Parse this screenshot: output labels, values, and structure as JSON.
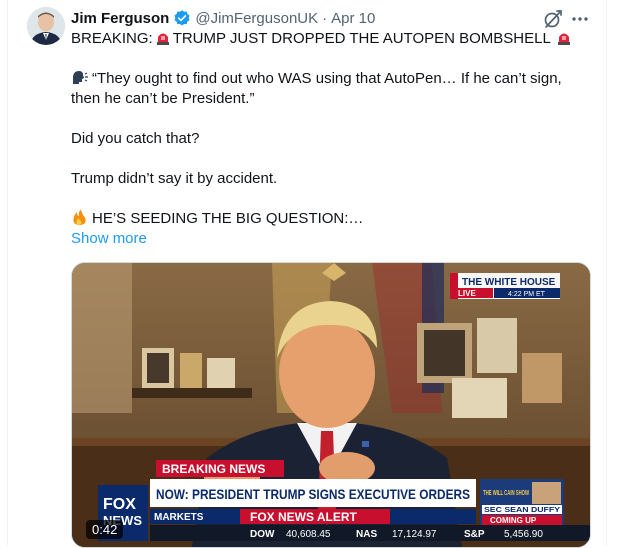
{
  "tweet": {
    "author_name": "Jim Ferguson",
    "handle": "@JimFergusonUK",
    "separator": "·",
    "date": "Apr 10",
    "line1_prefix": "BREAKING:",
    "line1_text": "TRUMP JUST DROPPED THE AUTOPEN BOMBSHELL",
    "quote_line1": "“They ought to find out who WAS using that AutoPen… If he can’t sign,",
    "quote_line2": "then he can’t be President.”",
    "para2": "Did you catch that?",
    "para3": "Trump didn’t say it by accident.",
    "para4": "HE’S SEEDING THE BIG QUESTION:…",
    "show_more": "Show more"
  },
  "video": {
    "duration": "0:42",
    "channel_bug": "THE WHITE HOUSE",
    "live_label": "LIVE",
    "live_time": "4:22 PM ET",
    "breaking_label": "BREAKING NEWS",
    "headline": "NOW: PRESIDENT TRUMP SIGNS EXECUTIVE ORDERS",
    "alert_label": "FOX NEWS ALERT",
    "markets_label": "MARKETS",
    "show_promo_top": "THE WILL CAIN SHOW",
    "show_promo_name": "SEC SEAN DUFFY",
    "show_promo_coming": "COMING UP",
    "ticker": [
      {
        "label": "DOW",
        "value": "40,608.45"
      },
      {
        "label": "NAS",
        "value": "17,124.97"
      },
      {
        "label": "S&P",
        "value": "5,456.90"
      }
    ],
    "fox_logo_line1": "FOX",
    "fox_logo_line2": "NEWS"
  },
  "icons": {
    "verified": "verified-badge-icon",
    "grok": "grok-icon",
    "more": "more-options-icon",
    "siren": "siren-emoji-icon",
    "speaking_head": "speaking-head-emoji-icon",
    "fire": "fire-emoji-icon"
  },
  "colors": {
    "link": "#1d9bf0",
    "muted": "#536471",
    "verified": "#1d9bf0",
    "fox_red": "#c8102e",
    "fox_blue": "#0b2a6b"
  }
}
